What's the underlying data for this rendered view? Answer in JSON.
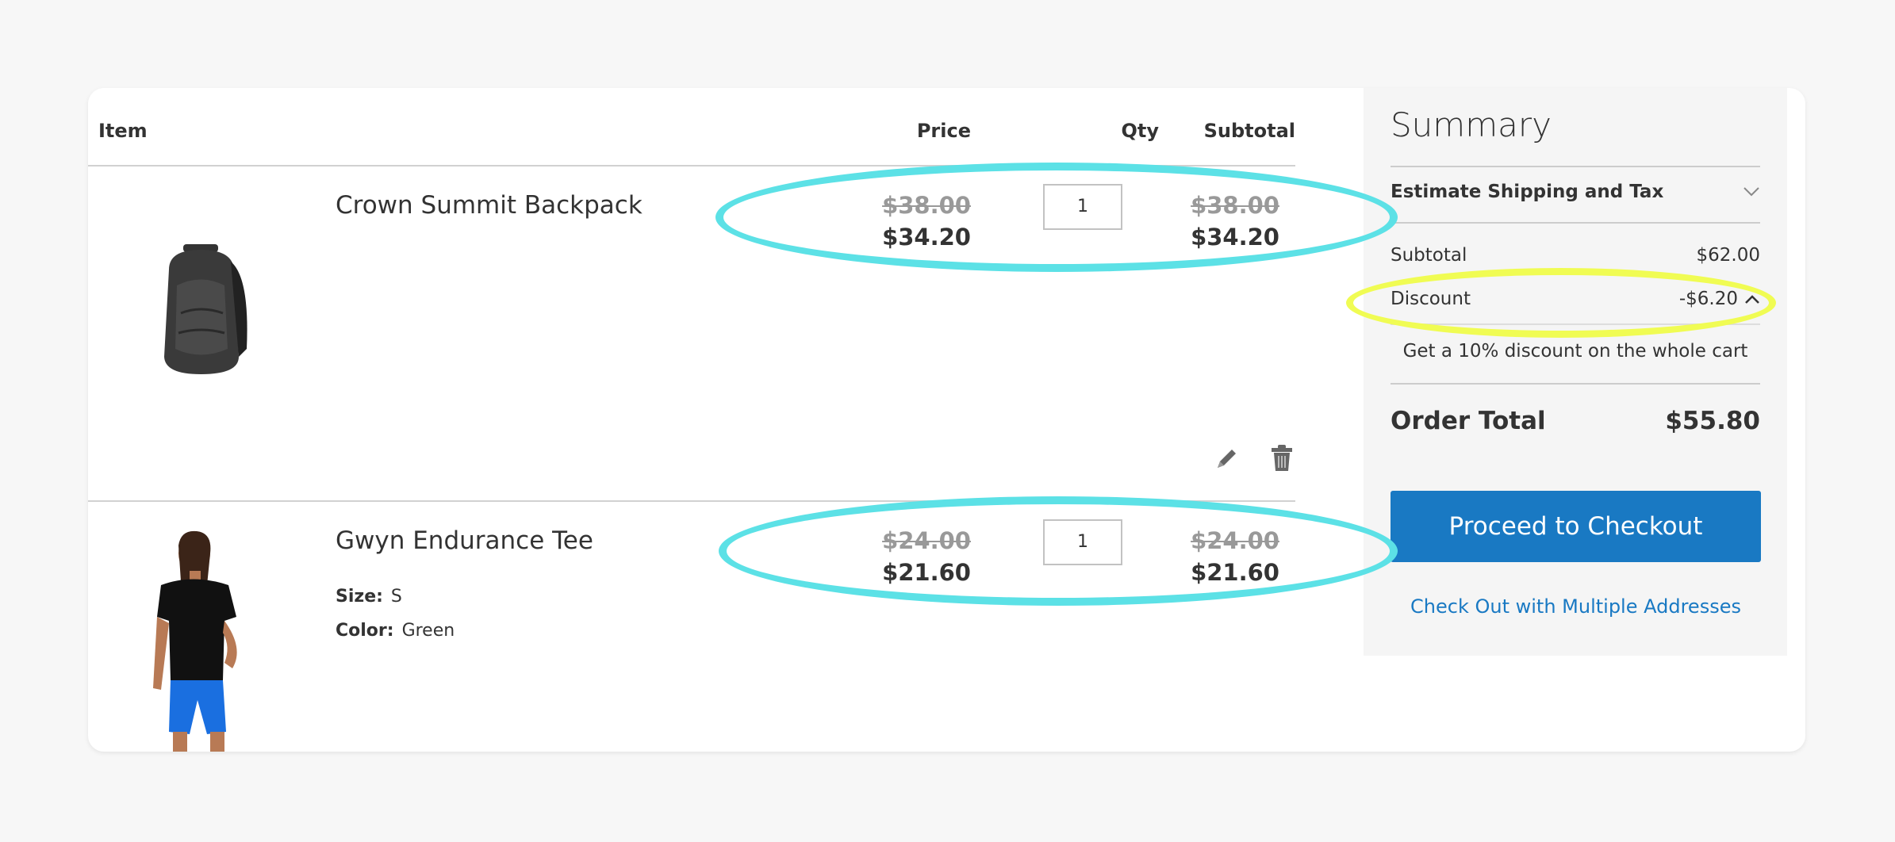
{
  "table": {
    "headers": {
      "item": "Item",
      "price": "Price",
      "qty": "Qty",
      "subtotal": "Subtotal"
    },
    "rows": [
      {
        "name": "Crown Summit Backpack",
        "price_original": "$38.00",
        "price_discounted": "$34.20",
        "qty": "1",
        "subtotal_original": "$38.00",
        "subtotal_discounted": "$34.20",
        "image": "backpack-product-image",
        "actions": [
          "edit-icon",
          "trash-icon"
        ]
      },
      {
        "name": "Gwyn Endurance Tee",
        "options": [
          {
            "label": "Size:",
            "value": "S"
          },
          {
            "label": "Color:",
            "value": "Green"
          }
        ],
        "price_original": "$24.00",
        "price_discounted": "$21.60",
        "qty": "1",
        "subtotal_original": "$24.00",
        "subtotal_discounted": "$21.60",
        "image": "tee-product-image"
      }
    ]
  },
  "summary": {
    "title": "Summary",
    "estimate_label": "Estimate Shipping and Tax",
    "subtotal_label": "Subtotal",
    "subtotal_value": "$62.00",
    "discount_label": "Discount",
    "discount_value": "-$6.20",
    "discount_description": "Get a 10% discount on the whole cart",
    "order_total_label": "Order Total",
    "order_total_value": "$55.80",
    "checkout_button": "Proceed to Checkout",
    "multi_address_link": "Check Out with Multiple Addresses"
  },
  "colors": {
    "accent_blue": "#1979c3",
    "highlight_cyan": "#5ce1e6",
    "highlight_yellow": "#f0fc53"
  }
}
